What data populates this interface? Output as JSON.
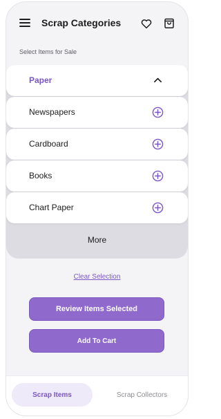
{
  "header": {
    "title": "Scrap Categories",
    "icons": [
      "menu-icon",
      "heart-icon",
      "bag-icon"
    ]
  },
  "subheading": "Select Items for Sale",
  "category": {
    "name": "Paper",
    "expanded": true,
    "items": [
      {
        "label": "Newspapers"
      },
      {
        "label": "Cardboard"
      },
      {
        "label": "Books"
      },
      {
        "label": "Chart Paper"
      }
    ],
    "more_label": "More"
  },
  "actions": {
    "clear_label": "Clear Selection",
    "review_label": "Review Items Selected",
    "cart_label": "Add To Cart"
  },
  "bottom_nav": {
    "tabs": [
      {
        "label": "Scrap Items",
        "active": true
      },
      {
        "label": "Scrap Collectors",
        "active": false
      }
    ]
  },
  "colors": {
    "accent": "#7a56c0",
    "button_fill": "#8f69cc",
    "background": "#f4f4f6",
    "panel": "#dcdce2"
  }
}
